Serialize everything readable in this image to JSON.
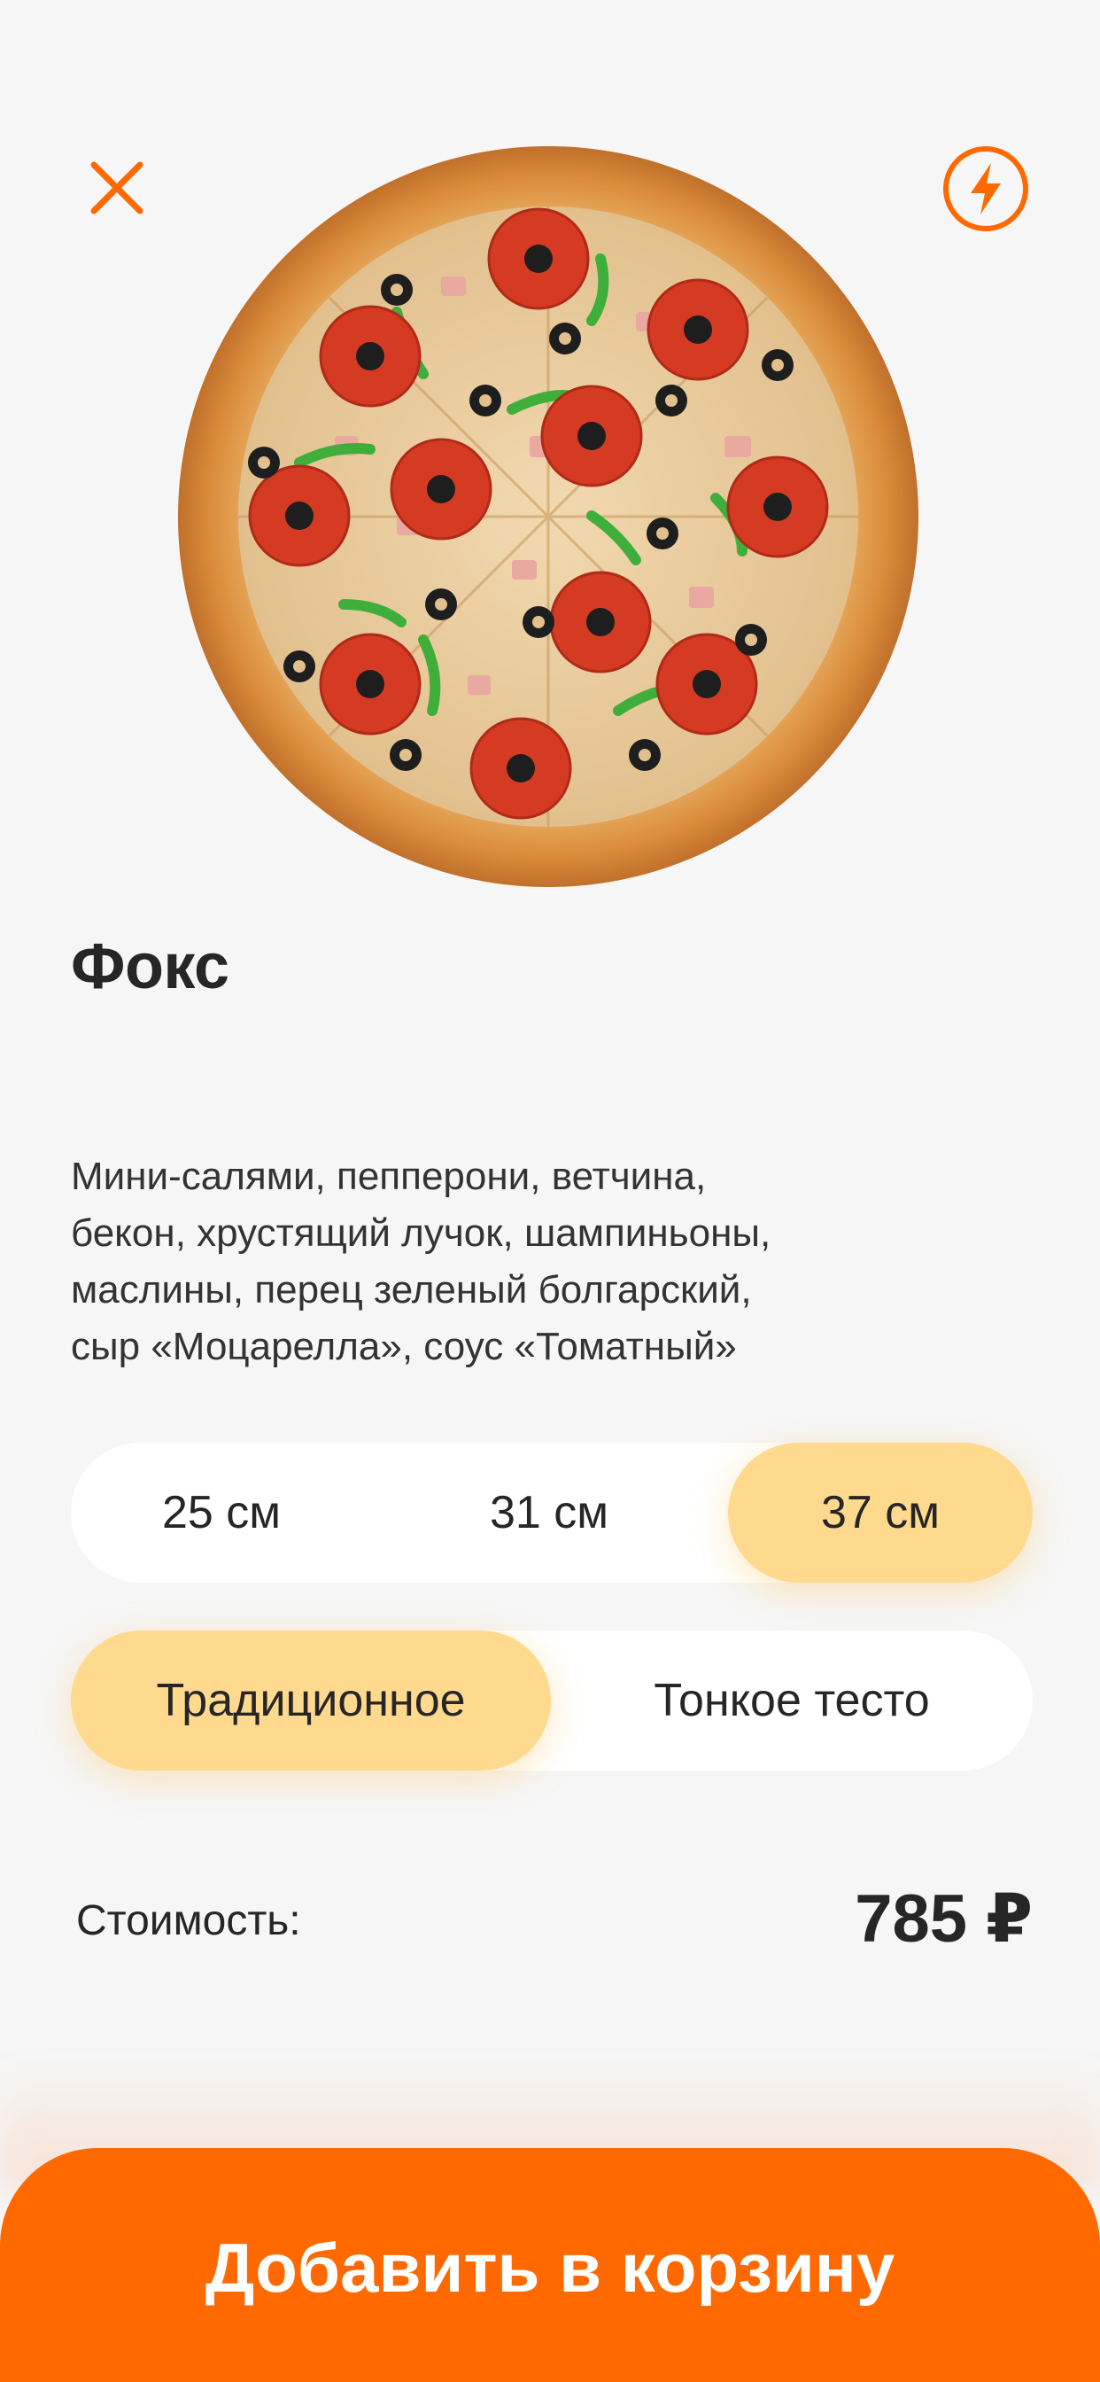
{
  "colors": {
    "accent": "#ff6900",
    "selected_segment": "#ffd98e",
    "background": "#f6f6f6"
  },
  "header": {
    "close_icon": "close-icon",
    "quick_order_icon": "lightning-bolt-icon"
  },
  "product": {
    "image": "pizza-image",
    "title": "Фокс",
    "description_lines": [
      "Мини-салями, пепперони, ветчина,",
      "бекон, хрустящий лучок, шампиньоны,",
      "маслины, перец зеленый болгарский,",
      "сыр «Моцарелла», соус «Томатный»"
    ]
  },
  "sizes": {
    "options": [
      "25 см",
      "31 см",
      "37 см"
    ],
    "selected": "37 см"
  },
  "dough": {
    "options": [
      "Традиционное",
      "Тонкое тесто"
    ],
    "selected": "Традиционное"
  },
  "price": {
    "label": "Стоимость:",
    "value": "785 ₽"
  },
  "cart": {
    "button_label": "Добавить в корзину"
  }
}
